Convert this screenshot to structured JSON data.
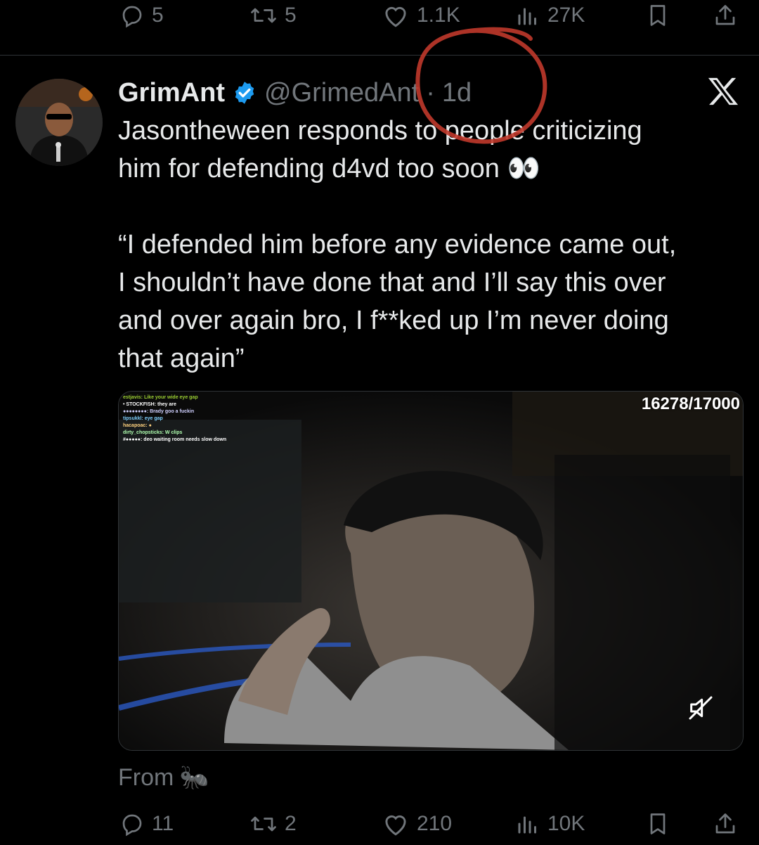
{
  "top_actions": {
    "replies": "5",
    "reposts": "5",
    "likes": "1.1K",
    "views": "27K"
  },
  "tweet": {
    "display_name": "GrimAnt",
    "handle": "@GrimedAnt",
    "separator": "·",
    "time": "1d",
    "body_lines": [
      "Jasontheween responds to people criticizing",
      "him for defending d4vd too soon 👀",
      "“I defended him before any evidence came out,",
      "I shouldn’t have done that and I’ll say this over",
      "and over again bro, I f**ked up I’m never doing",
      "that again”"
    ],
    "media": {
      "counter": "16278/17000",
      "chat": [
        "estjavis: Like your wide eye gap",
        "• STOCKFISH: they are",
        "●●●●●●●●: Brady goo a fuckin",
        "tipsukkl: eye gap",
        "hacapoac: ●",
        "dirty_chopsticks: W clips",
        "#●●●●●: deo waiting room needs slow down"
      ]
    },
    "from_label": "From",
    "from_emoji": "🐜"
  },
  "bottom_actions": {
    "replies": "11",
    "reposts": "2",
    "likes": "210",
    "views": "10K"
  },
  "colors": {
    "background": "#000000",
    "text": "#e7e9ea",
    "muted": "#71767b",
    "verified": "#1d9bf0",
    "annotation": "#c0392b"
  }
}
